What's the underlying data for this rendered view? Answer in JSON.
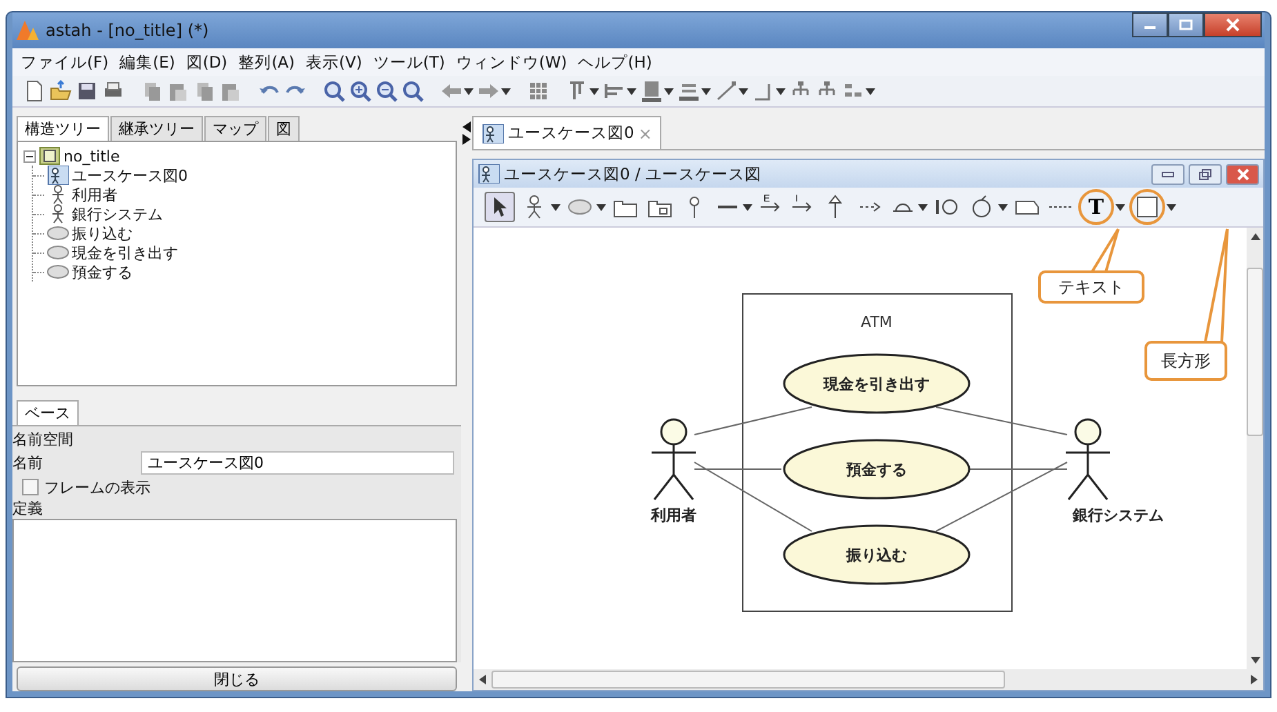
{
  "window": {
    "title": "astah - [no_title] (*)"
  },
  "menu": [
    "ファイル(F)",
    "編集(E)",
    "図(D)",
    "整列(A)",
    "表示(V)",
    "ツール(T)",
    "ウィンドウ(W)",
    "ヘルプ(H)"
  ],
  "tree_tabs": [
    {
      "label": "構造ツリー",
      "selected": true
    },
    {
      "label": "継承ツリー",
      "selected": false
    },
    {
      "label": "マップ",
      "selected": false
    },
    {
      "label": "図",
      "selected": false
    }
  ],
  "tree": {
    "label": "no_title",
    "kind": "project",
    "expanded": true,
    "children": [
      {
        "label": "ユースケース図0",
        "kind": "diagram"
      },
      {
        "label": "利用者",
        "kind": "actor"
      },
      {
        "label": "銀行システム",
        "kind": "actor"
      },
      {
        "label": "振り込む",
        "kind": "usecase"
      },
      {
        "label": "現金を引き出す",
        "kind": "usecase"
      },
      {
        "label": "預金する",
        "kind": "usecase"
      }
    ]
  },
  "property_tabs": [
    {
      "label": "ベース",
      "selected": true
    }
  ],
  "properties": {
    "namespace_label": "名前空間",
    "name_label": "名前",
    "name_value": "ユースケース図0",
    "frame_checkbox": {
      "label": "フレームの表示",
      "checked": false
    },
    "definition_label": "定義"
  },
  "close_button": "閉じる",
  "editor_tabs": [
    {
      "label": "ユースケース図0",
      "close": "×",
      "selected": true
    }
  ],
  "diagram_window": {
    "title": "ユースケース図0 / ユースケース図"
  },
  "palette": [
    {
      "kind": "select",
      "selected": true,
      "highlighted": false
    },
    {
      "kind": "actor",
      "selected": false,
      "highlighted": false
    },
    {
      "kind": "usecase",
      "selected": false,
      "highlighted": false
    },
    {
      "kind": "package",
      "selected": false,
      "highlighted": false
    },
    {
      "kind": "subsystem",
      "selected": false,
      "highlighted": false
    },
    {
      "kind": "pin",
      "selected": false,
      "highlighted": false
    },
    {
      "kind": "association",
      "selected": false,
      "highlighted": false
    },
    {
      "kind": "extend",
      "label": "E",
      "selected": false,
      "highlighted": false
    },
    {
      "kind": "include",
      "label": "I",
      "selected": false,
      "highlighted": false
    },
    {
      "kind": "generalization",
      "selected": false,
      "highlighted": false
    },
    {
      "kind": "dependency",
      "selected": false,
      "highlighted": false
    },
    {
      "kind": "interface",
      "selected": false,
      "highlighted": false
    },
    {
      "kind": "realize",
      "selected": false,
      "highlighted": false
    },
    {
      "kind": "control",
      "selected": false,
      "highlighted": false
    },
    {
      "kind": "note",
      "selected": false,
      "highlighted": false
    },
    {
      "kind": "noteline",
      "selected": false,
      "highlighted": false
    },
    {
      "kind": "text",
      "label": "T",
      "selected": false,
      "highlighted": true
    },
    {
      "kind": "rectangle",
      "selected": false,
      "highlighted": true
    }
  ],
  "diagram": {
    "system": "ATM",
    "use_cases": [
      "現金を引き出す",
      "預金する",
      "振り込む"
    ],
    "actors": [
      "利用者",
      "銀行システム"
    ],
    "callouts": [
      "テキスト",
      "長方形"
    ]
  }
}
